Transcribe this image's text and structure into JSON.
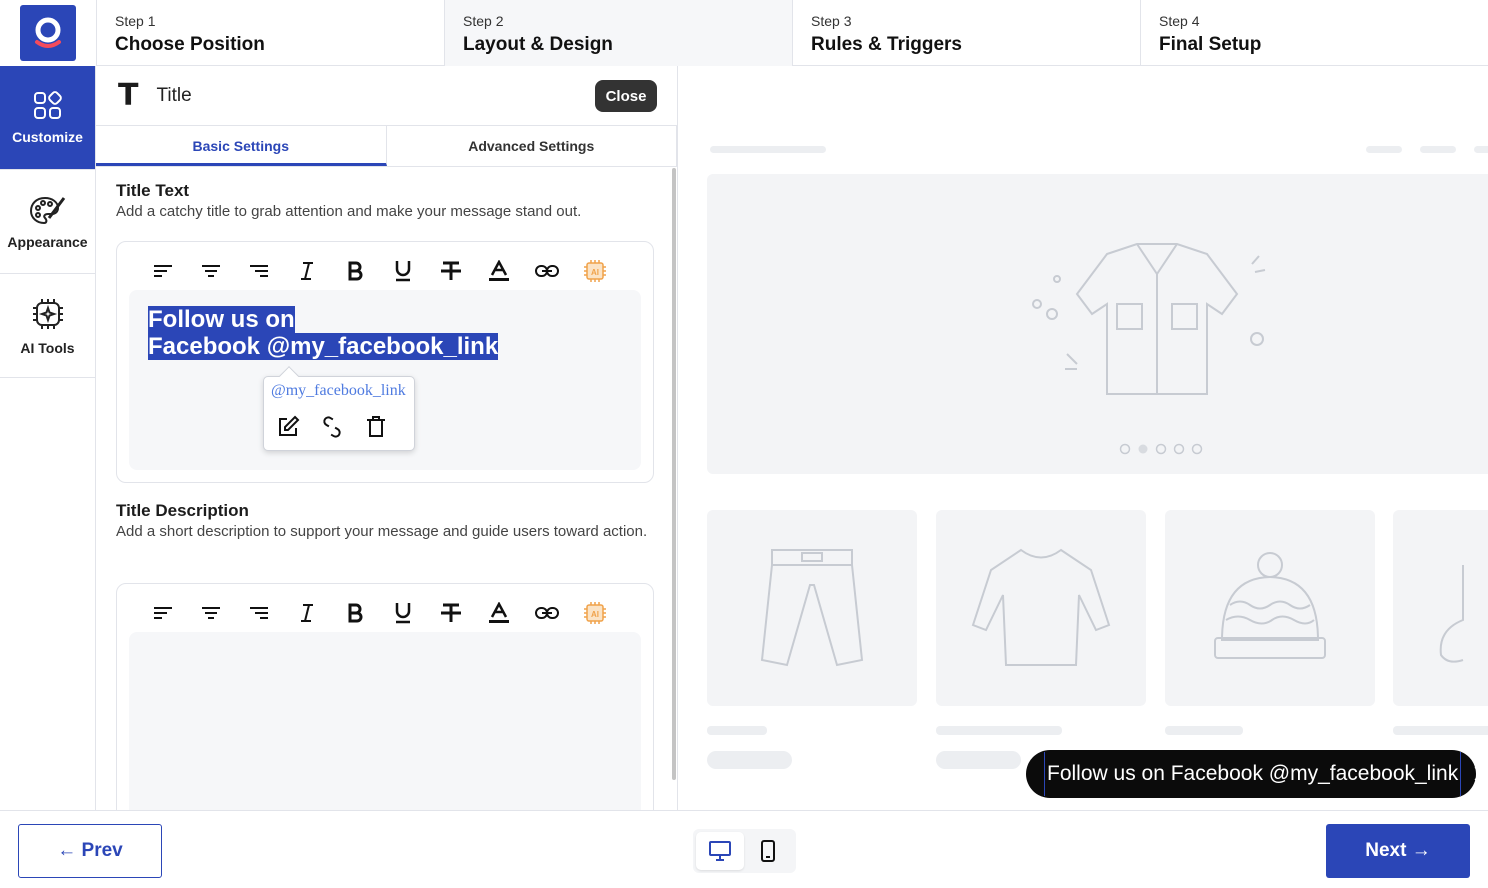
{
  "steps": [
    {
      "num": "Step 1",
      "title": "Choose Position"
    },
    {
      "num": "Step 2",
      "title": "Layout & Design"
    },
    {
      "num": "Step 3",
      "title": "Rules & Triggers"
    },
    {
      "num": "Step 4",
      "title": "Final Setup"
    }
  ],
  "active_step": "Step 2",
  "sidebar": {
    "items": [
      {
        "label": "Customize",
        "icon": "grid-icon",
        "active": true
      },
      {
        "label": "Appearance",
        "icon": "palette-icon",
        "active": false
      },
      {
        "label": "AI Tools",
        "icon": "chip-icon",
        "active": false
      }
    ]
  },
  "panel": {
    "title_icon": "T",
    "title": "Title",
    "close_label": "Close",
    "tabs": [
      {
        "label": "Basic Settings",
        "active": true
      },
      {
        "label": "Advanced Settings",
        "active": false
      }
    ],
    "title_text": {
      "heading": "Title Text",
      "description": "Add a catchy title to grab attention and make your message stand out.",
      "content_line1": "Follow us on",
      "content_line2": "Facebook @my_facebook_link",
      "link_popup_url": "@my_facebook_link"
    },
    "title_description": {
      "heading": "Title Description",
      "description": "Add a short description to support your message and guide users toward action."
    },
    "toolbar_icons": [
      "align-left-icon",
      "align-center-icon",
      "align-right-icon",
      "italic-icon",
      "bold-icon",
      "underline-icon",
      "strikethrough-icon",
      "text-color-icon",
      "link-icon",
      "ai-icon"
    ]
  },
  "preview": {
    "toast_text": "Follow us on Facebook @my_facebook_link",
    "toast_close": "✕"
  },
  "footer": {
    "prev_label": "← Prev",
    "next_label": "Next →",
    "device_active": "desktop"
  },
  "colors": {
    "brand": "#2b46b7",
    "ai_accent": "#f0a24a",
    "toast_bg": "#0b0b0b"
  }
}
